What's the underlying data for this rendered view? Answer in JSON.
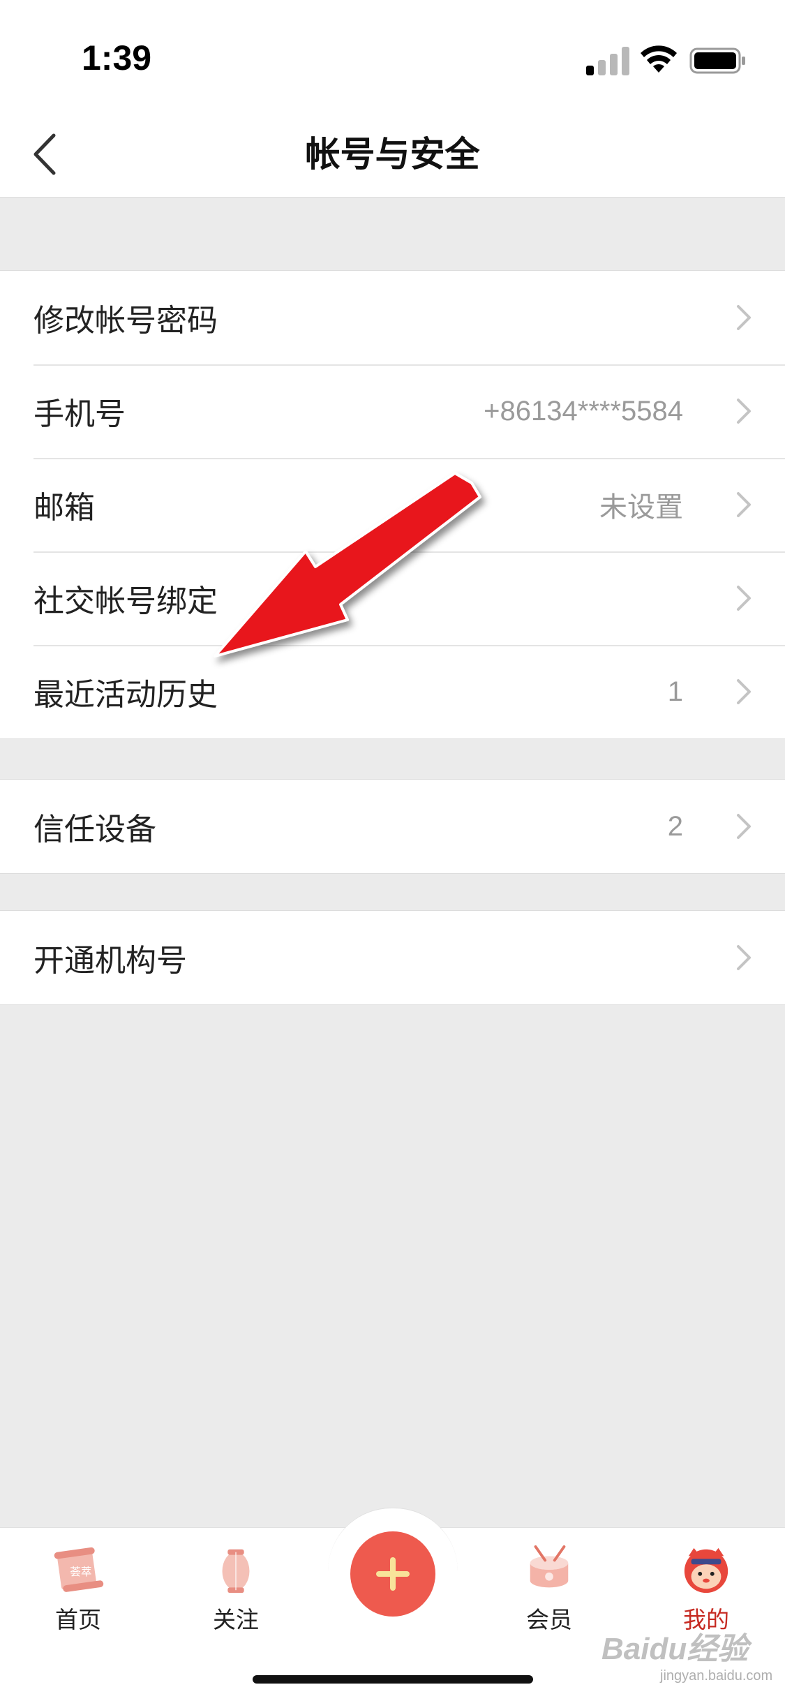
{
  "status_bar": {
    "time": "1:39"
  },
  "nav": {
    "title": "帐号与安全"
  },
  "groups": [
    {
      "rows": [
        {
          "label": "修改帐号密码",
          "value": ""
        },
        {
          "label": "手机号",
          "value": "+86134****5584"
        },
        {
          "label": "邮箱",
          "value": "未设置"
        },
        {
          "label": "社交帐号绑定",
          "value": ""
        },
        {
          "label": "最近活动历史",
          "value": "1"
        }
      ]
    },
    {
      "rows": [
        {
          "label": "信任设备",
          "value": "2"
        }
      ]
    },
    {
      "rows": [
        {
          "label": "开通机构号",
          "value": ""
        }
      ]
    }
  ],
  "tabs": [
    {
      "label": "首页"
    },
    {
      "label": "关注"
    },
    {
      "label": "会员"
    },
    {
      "label": "我的",
      "active": true
    }
  ],
  "watermark": {
    "text": "Baidu经验",
    "sub": "jingyan.baidu.com"
  },
  "colors": {
    "accent": "#ee5a4e",
    "active_tab": "#c62a22",
    "annotation_arrow": "#e8141a"
  }
}
